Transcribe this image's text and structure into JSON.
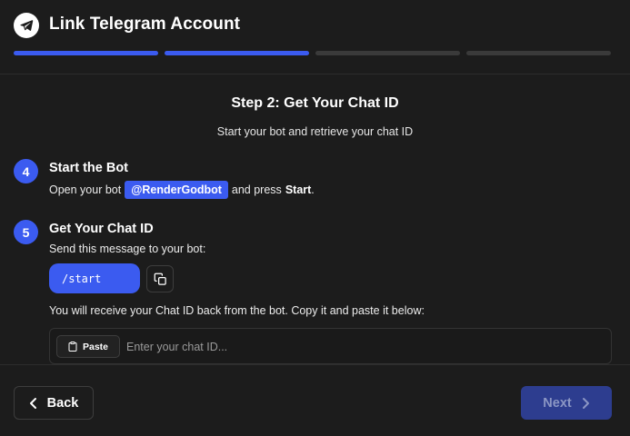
{
  "header": {
    "title": "Link Telegram Account",
    "progress": {
      "total_steps": 4,
      "completed_steps": 2
    }
  },
  "step": {
    "title": "Step 2: Get Your Chat ID",
    "subtitle": "Start your bot and retrieve your chat ID"
  },
  "items": [
    {
      "number": "4",
      "title": "Start the Bot",
      "text_before": "Open your bot",
      "bot_name": "@RenderGodbot",
      "text_after": "and press",
      "text_bold": "Start",
      "text_end": "."
    },
    {
      "number": "5",
      "title": "Get Your Chat ID",
      "instruction": "Send this message to your bot:",
      "command": "/start",
      "receive_text": "You will receive your Chat ID back from the bot. Copy it and paste it below:"
    }
  ],
  "chat_input": {
    "paste_label": "Paste",
    "placeholder": "Enter your chat ID...",
    "value": ""
  },
  "footer": {
    "back_label": "Back",
    "next_label": "Next"
  },
  "colors": {
    "accent": "#3b5bf0",
    "background": "#1c1c1c",
    "next_disabled_bg": "#2d3d8f"
  },
  "icons": [
    "telegram-icon",
    "copy-icon",
    "clipboard-icon",
    "chevron-left-icon",
    "chevron-right-icon"
  ]
}
